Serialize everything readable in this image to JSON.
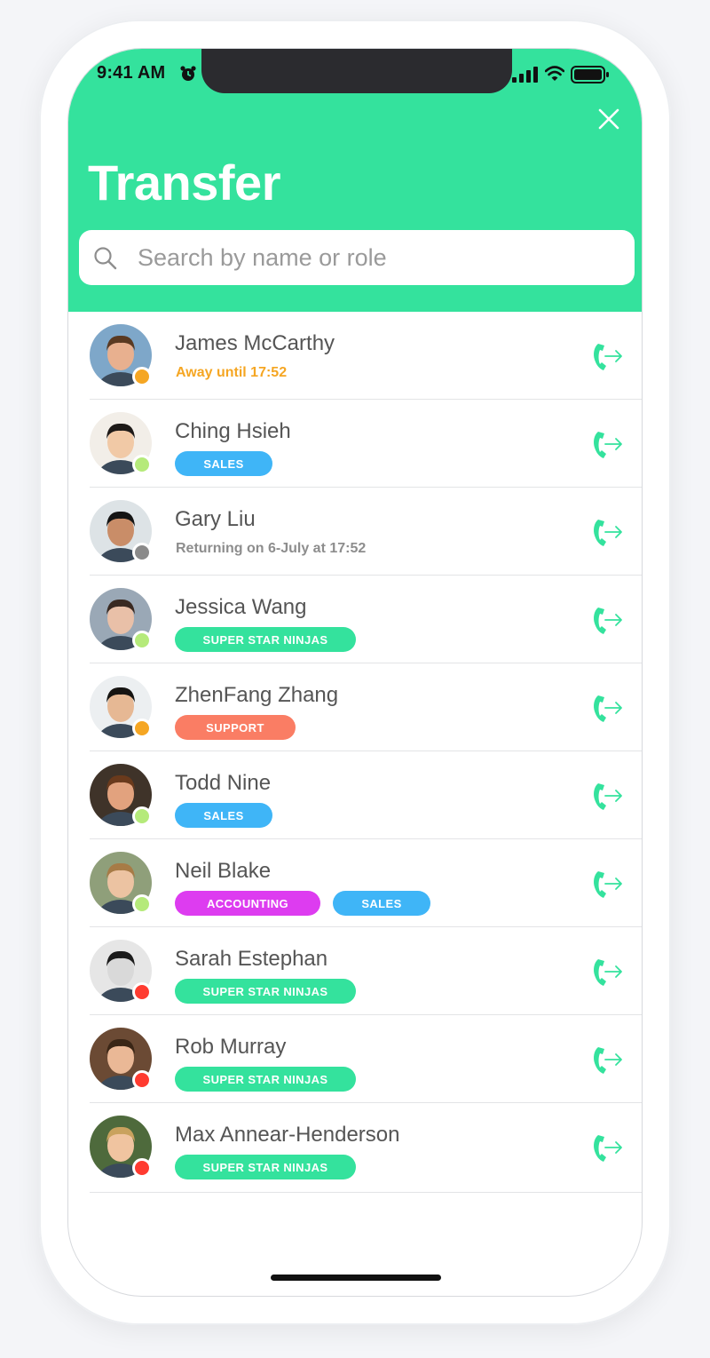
{
  "status_bar": {
    "time": "9:41 AM"
  },
  "header": {
    "title": "Transfer",
    "search_placeholder": "Search by name or role"
  },
  "colors": {
    "accent": "#34e29d",
    "away": "#f5a623",
    "online": "#b5ea7a",
    "offline": "#8a8a8a",
    "busy": "#ff3b30",
    "tag_sales": "#3fb5f7",
    "tag_ninjas": "#34e29d",
    "tag_support": "#fa7d64",
    "tag_accounting": "#dd3cf0"
  },
  "contacts": [
    {
      "name": "James McCarthy",
      "status": "away",
      "subtitle": "Away until 17:52",
      "tags": []
    },
    {
      "name": "Ching Hsieh",
      "status": "online",
      "subtitle": "",
      "tags": [
        "SALES"
      ]
    },
    {
      "name": "Gary Liu",
      "status": "offline",
      "subtitle": "Returning on 6-July at 17:52",
      "tags": []
    },
    {
      "name": "Jessica Wang",
      "status": "online",
      "subtitle": "",
      "tags": [
        "SUPER STAR NINJAS"
      ]
    },
    {
      "name": "ZhenFang Zhang",
      "status": "away",
      "subtitle": "",
      "tags": [
        "SUPPORT"
      ]
    },
    {
      "name": "Todd Nine",
      "status": "online",
      "subtitle": "",
      "tags": [
        "SALES"
      ]
    },
    {
      "name": "Neil Blake",
      "status": "online",
      "subtitle": "",
      "tags": [
        "ACCOUNTING",
        "SALES"
      ]
    },
    {
      "name": "Sarah Estephan",
      "status": "busy",
      "subtitle": "",
      "tags": [
        "SUPER STAR NINJAS"
      ]
    },
    {
      "name": "Rob Murray",
      "status": "busy",
      "subtitle": "",
      "tags": [
        "SUPER STAR NINJAS"
      ]
    },
    {
      "name": "Max Annear-Henderson",
      "status": "busy",
      "subtitle": "",
      "tags": [
        "SUPER STAR NINJAS"
      ]
    }
  ]
}
